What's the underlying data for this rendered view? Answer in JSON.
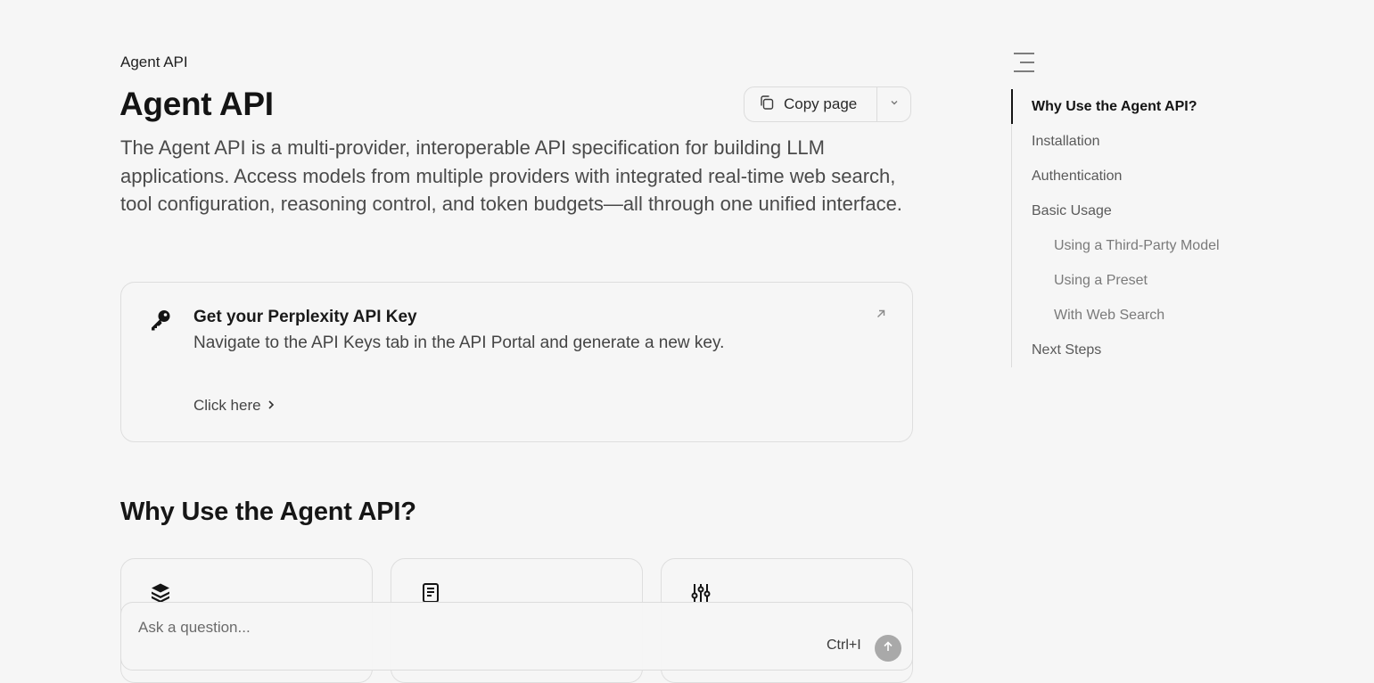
{
  "breadcrumb": "Agent API",
  "page_title": "Agent API",
  "copy_page": {
    "label": "Copy page"
  },
  "intro": "The Agent API is a multi-provider, interoperable API specification for building LLM applications. Access models from multiple providers with integrated real-time web search, tool configuration, reasoning control, and token budgets—all through one unified interface.",
  "api_key_card": {
    "title": "Get your Perplexity API Key",
    "description": "Navigate to the API Keys tab in the API Portal and generate a new key.",
    "link_label": "Click here"
  },
  "section_title": "Why Use the Agent API?",
  "feature_cards": [
    {
      "icon": "layers-icon"
    },
    {
      "icon": "document-icon"
    },
    {
      "icon": "sliders-icon"
    }
  ],
  "ask": {
    "placeholder": "Ask a question...",
    "shortcut": "Ctrl+I"
  },
  "toc": {
    "items": [
      {
        "label": "Why Use the Agent API?",
        "active": true,
        "level": 1
      },
      {
        "label": "Installation",
        "level": 1
      },
      {
        "label": "Authentication",
        "level": 1
      },
      {
        "label": "Basic Usage",
        "level": 1
      },
      {
        "label": "Using a Third-Party Model",
        "level": 2
      },
      {
        "label": "Using a Preset",
        "level": 2
      },
      {
        "label": "With Web Search",
        "level": 2
      },
      {
        "label": "Next Steps",
        "level": 1
      }
    ]
  }
}
